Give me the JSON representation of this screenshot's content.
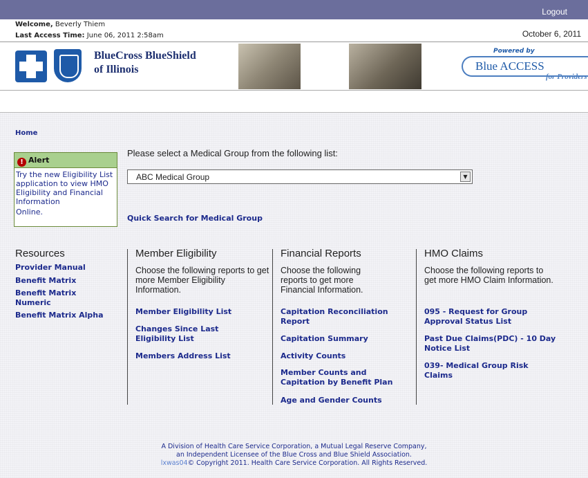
{
  "header": {
    "logout": "Logout",
    "welcome_label": "Welcome,",
    "welcome_name": "Beverly Thiem",
    "last_access_label": "Last Access Time:",
    "last_access_value": "June 06, 2011 2:58am",
    "date": "October 6, 2011"
  },
  "banner": {
    "brand_line1": "BlueCross BlueShield",
    "brand_line2": "of Illinois",
    "powered_by": "Powered by",
    "product": "Blue ACCESS",
    "for_providers": "for Providers"
  },
  "nav": {
    "home": "Home"
  },
  "alert": {
    "title": "Alert",
    "body": "Try the new Eligibility List application to view HMO Eligibility and Financial Information",
    "link": "Online."
  },
  "group_select": {
    "prompt": "Please select a Medical Group from the following list:",
    "selected": "ABC Medical Group",
    "quick_search": "Quick Search for Medical Group"
  },
  "resources": {
    "title": "Resources",
    "links": [
      "Provider Manual",
      "Benefit Matrix",
      "Benefit Matrix Numeric",
      "Benefit Matrix Alpha"
    ]
  },
  "member_eligibility": {
    "title": "Member Eligibility",
    "desc": "Choose the following reports to get more Member Eligibility Information.",
    "links": [
      "Member Eligibility List",
      "Changes Since Last Eligibility List",
      "Members Address List"
    ]
  },
  "financial_reports": {
    "title": "Financial Reports",
    "desc": "Choose the following reports to get more Financial Information.",
    "links": [
      "Capitation Reconciliation Report",
      "Capitation Summary",
      "Activity Counts",
      "Member Counts and Capitation by Benefit Plan",
      "Age and Gender Counts"
    ]
  },
  "hmo_claims": {
    "title": "HMO Claims",
    "desc": "Choose the following reports to get more HMO Claim Information.",
    "links": [
      "095 - Request for Group Approval Status List",
      "Past Due Claims(PDC) - 10 Day Notice List",
      "039- Medical Group Risk Claims"
    ]
  },
  "footer": {
    "line1": "A Division of Health Care Service Corporation, a Mutual Legal Reserve Company,",
    "line2": "an Independent Licensee of the Blue Cross and Blue Shield Association.",
    "server_id": "lxwas04",
    "line3": "© Copyright 2011. Health Care Service Corporation. All Rights Reserved."
  }
}
